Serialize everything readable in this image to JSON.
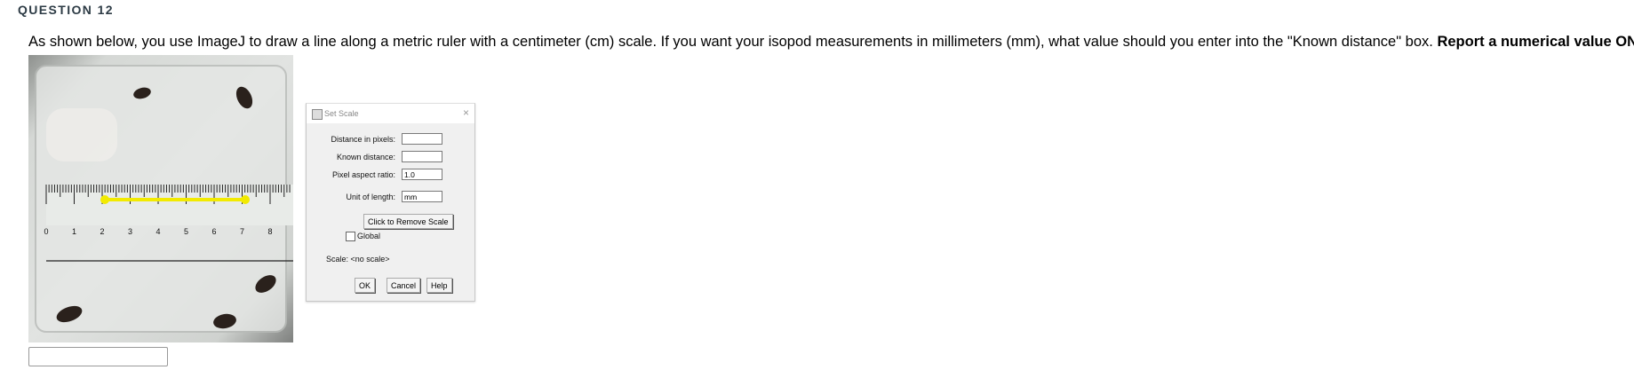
{
  "question": {
    "title": "QUESTION 12",
    "text": "As shown below, you use ImageJ to draw a line along a metric ruler with a centimeter (cm) scale.  If you want your isopod measurements in millimeters (mm), what value should you enter into the \"Known distance\" box.  ",
    "bold_text": "Report a numerical value ONLY."
  },
  "photo": {
    "ruler_numbers": [
      "0",
      "1",
      "2",
      "3",
      "4",
      "5",
      "6",
      "7",
      "8"
    ],
    "highlight_color": "#f2ea00",
    "photo_background": "#d9dcd9"
  },
  "dialog": {
    "title": "Set Scale",
    "close_icon": "close-icon",
    "fields": {
      "distance_label": "Distance in pixels:",
      "distance_value": "",
      "known_label": "Known distance:",
      "known_value": "",
      "aspect_label": "Pixel aspect ratio:",
      "aspect_value": "1.0",
      "unit_label": "Unit of length:",
      "unit_value": "mm"
    },
    "remove_scale_label": "Click to Remove Scale",
    "global_label": "Global",
    "scale_text": "Scale: <no scale>",
    "ok_label": "OK",
    "cancel_label": "Cancel",
    "help_label": "Help"
  },
  "answer": {
    "value": ""
  }
}
